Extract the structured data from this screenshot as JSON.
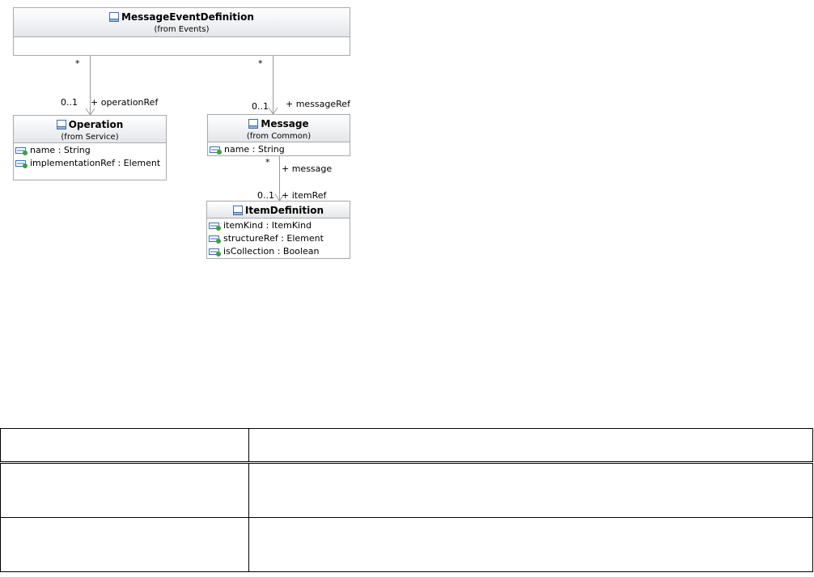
{
  "classes": {
    "message_event_definition": {
      "name": "MessageEventDefinition",
      "from": "(from Events)"
    },
    "operation": {
      "name": "Operation",
      "from": "(from Service)",
      "attributes": [
        "name : String",
        "implementationRef : Element"
      ]
    },
    "message": {
      "name": "Message",
      "from": "(from Common)",
      "attributes": [
        "name : String"
      ]
    },
    "item_definition": {
      "name": "ItemDefinition",
      "attributes": [
        "itemKind : ItemKind",
        "structureRef : Element",
        "isCollection : Boolean"
      ]
    }
  },
  "associations": {
    "operation_ref": {
      "source_multiplicity": "*",
      "target_multiplicity": "0..1",
      "role": "+ operationRef"
    },
    "message_ref": {
      "source_multiplicity": "*",
      "target_multiplicity": "0..1",
      "role": "+ messageRef"
    },
    "item_ref": {
      "source_multiplicity": "*",
      "source_role": "+ message",
      "target_multiplicity": "0..1",
      "role": "+ itemRef"
    }
  },
  "colors": {
    "class_border": "#a9a9a9",
    "connector": "#9a9a9a",
    "class_icon": "#3a6fb0",
    "attr_icon_dot": "#3ca03c"
  },
  "icons": {
    "class": "class-icon",
    "attribute": "attribute-icon"
  }
}
